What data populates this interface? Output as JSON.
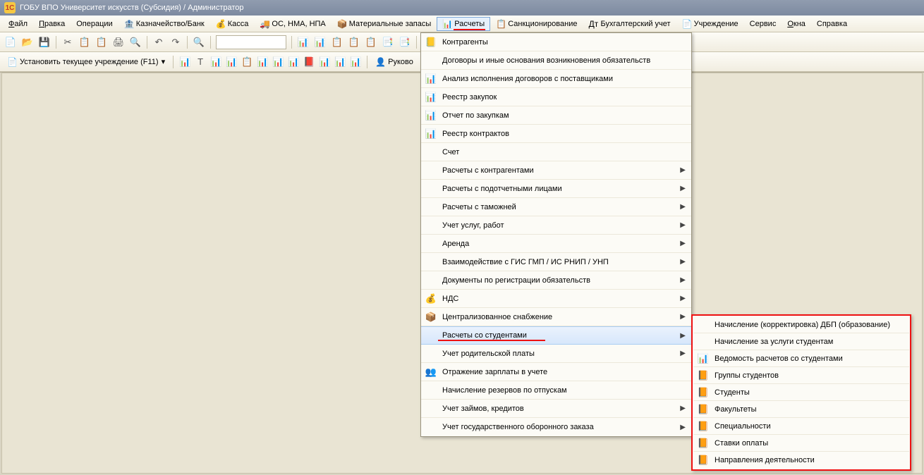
{
  "title": "ГОБУ ВПО Университет искусств (Субсидия) / Администратор",
  "menubar": [
    {
      "label": "Файл",
      "u": 0
    },
    {
      "label": "Правка",
      "u": 0
    },
    {
      "label": "Операции"
    },
    {
      "icon": "🏦",
      "label": "Казначейство/Банк"
    },
    {
      "icon": "💰",
      "label": "Касса"
    },
    {
      "icon": "🚚",
      "label": "ОС, НМА, НПА"
    },
    {
      "icon": "📦",
      "label": "Материальные запасы"
    },
    {
      "icon": "📊",
      "label": "Расчеты",
      "active": true,
      "red": true
    },
    {
      "icon": "📋",
      "label": "Санкционирование"
    },
    {
      "icon": "Дт",
      "label": "Бухгалтерский учет"
    },
    {
      "icon": "📄",
      "label": "Учреждение"
    },
    {
      "label": "Сервис"
    },
    {
      "label": "Окна",
      "u": 0
    },
    {
      "label": "Справка"
    }
  ],
  "toolbar1_groups": [
    [
      "📄",
      "📂",
      "💾"
    ],
    [
      "✂",
      "📋",
      "📋",
      "🖨",
      "🔍"
    ],
    [
      "↶",
      "↷"
    ],
    [
      "🔍"
    ],
    [
      "search"
    ],
    [
      "📊",
      "📊",
      "📋",
      "📋",
      "📋",
      "📑",
      "📑"
    ],
    [
      "ℹ",
      "▾"
    ]
  ],
  "toolbar2": {
    "set_org": "Установить текущее учреждение (F11)",
    "buttons": [
      "📊",
      "T",
      "📊",
      "📊",
      "📋",
      "📊",
      "📊",
      "📊",
      "📕",
      "📊",
      "📊",
      "📊"
    ],
    "manager_label": "Руково"
  },
  "dropdown": [
    {
      "icon": "📒",
      "label": "Контрагенты"
    },
    {
      "icon": "",
      "label": "Договоры и иные основания возникновения обязательств"
    },
    {
      "icon": "📊",
      "label": "Анализ исполнения договоров с поставщиками"
    },
    {
      "icon": "📊",
      "label": "Реестр закупок"
    },
    {
      "icon": "📊",
      "label": "Отчет по закупкам"
    },
    {
      "icon": "📊",
      "label": "Реестр контрактов"
    },
    {
      "icon": "",
      "label": "Счет"
    },
    {
      "icon": "",
      "label": "Расчеты с контрагентами",
      "sub": true
    },
    {
      "icon": "",
      "label": "Расчеты с подотчетными лицами",
      "sub": true
    },
    {
      "icon": "",
      "label": "Расчеты с таможней",
      "sub": true
    },
    {
      "icon": "",
      "label": "Учет услуг, работ",
      "sub": true
    },
    {
      "icon": "",
      "label": "Аренда",
      "sub": true
    },
    {
      "icon": "",
      "label": "Взаимодействие с ГИС ГМП / ИС РНИП / УНП",
      "sub": true
    },
    {
      "icon": "",
      "label": "Документы по регистрации обязательств",
      "sub": true
    },
    {
      "icon": "💰",
      "label": "НДС",
      "sub": true
    },
    {
      "icon": "📦",
      "label": "Централизованное снабжение",
      "sub": true
    },
    {
      "icon": "",
      "label": "Расчеты со студентами",
      "sub": true,
      "hl": true
    },
    {
      "icon": "",
      "label": "Учет родительской платы",
      "sub": true
    },
    {
      "icon": "👥",
      "label": "Отражение зарплаты в учете"
    },
    {
      "icon": "",
      "label": "Начисление резервов по отпускам"
    },
    {
      "icon": "",
      "label": "Учет займов, кредитов",
      "sub": true
    },
    {
      "icon": "",
      "label": "Учет государственного оборонного заказа",
      "sub": true
    }
  ],
  "submenu": [
    {
      "icon": "",
      "label": "Начисление (корректировка) ДБП (образование)"
    },
    {
      "icon": "",
      "label": "Начисление за услуги студентам"
    },
    {
      "icon": "📊",
      "label": "Ведомость расчетов со студентами"
    },
    {
      "icon": "📙",
      "label": "Группы студентов"
    },
    {
      "icon": "📙",
      "label": "Студенты"
    },
    {
      "icon": "📙",
      "label": "Факультеты"
    },
    {
      "icon": "📙",
      "label": "Специальности"
    },
    {
      "icon": "📙",
      "label": "Ставки оплаты"
    },
    {
      "icon": "📙",
      "label": "Направления деятельности"
    }
  ]
}
